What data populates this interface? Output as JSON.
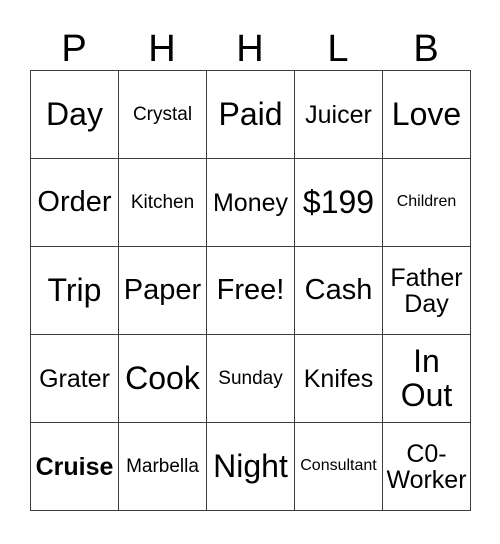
{
  "card": {
    "headers": [
      {
        "letter": "P"
      },
      {
        "letter": "H"
      },
      {
        "letter": "H"
      },
      {
        "letter": "L"
      },
      {
        "letter": "B"
      }
    ],
    "rows": [
      {
        "cells": [
          {
            "text": "Day",
            "size": "sz-xl",
            "weight": ""
          },
          {
            "text": "Crystal",
            "size": "sz-sm",
            "weight": ""
          },
          {
            "text": "Paid",
            "size": "sz-xl",
            "weight": ""
          },
          {
            "text": "Juicer",
            "size": "sz-md",
            "weight": ""
          },
          {
            "text": "Love",
            "size": "sz-xl",
            "weight": ""
          }
        ]
      },
      {
        "cells": [
          {
            "text": "Order",
            "size": "sz-lg",
            "weight": ""
          },
          {
            "text": "Kitchen",
            "size": "sz-sm",
            "weight": ""
          },
          {
            "text": "Money",
            "size": "sz-md",
            "weight": ""
          },
          {
            "text": "$199",
            "size": "sz-xl",
            "weight": ""
          },
          {
            "text": "Children",
            "size": "sz-xs",
            "weight": ""
          }
        ]
      },
      {
        "cells": [
          {
            "text": "Trip",
            "size": "sz-xl",
            "weight": ""
          },
          {
            "text": "Paper",
            "size": "sz-lg",
            "weight": ""
          },
          {
            "text": "Free!",
            "size": "sz-lg",
            "weight": ""
          },
          {
            "text": "Cash",
            "size": "sz-lg",
            "weight": ""
          },
          {
            "text": "Father\nDay",
            "size": "sz-md",
            "weight": ""
          }
        ]
      },
      {
        "cells": [
          {
            "text": "Grater",
            "size": "sz-md",
            "weight": ""
          },
          {
            "text": "Cook",
            "size": "sz-xl",
            "weight": ""
          },
          {
            "text": "Sunday",
            "size": "sz-sm",
            "weight": ""
          },
          {
            "text": "Knifes",
            "size": "sz-md",
            "weight": ""
          },
          {
            "text": "In\nOut",
            "size": "sz-xl",
            "weight": ""
          }
        ]
      },
      {
        "cells": [
          {
            "text": "Cruise",
            "size": "sz-md",
            "weight": "wt-bold"
          },
          {
            "text": "Marbella",
            "size": "sz-sm",
            "weight": ""
          },
          {
            "text": "Night",
            "size": "sz-xl",
            "weight": ""
          },
          {
            "text": "Consultant",
            "size": "sz-xs",
            "weight": ""
          },
          {
            "text": "C0-\nWorker",
            "size": "sz-md",
            "weight": ""
          }
        ]
      }
    ]
  }
}
